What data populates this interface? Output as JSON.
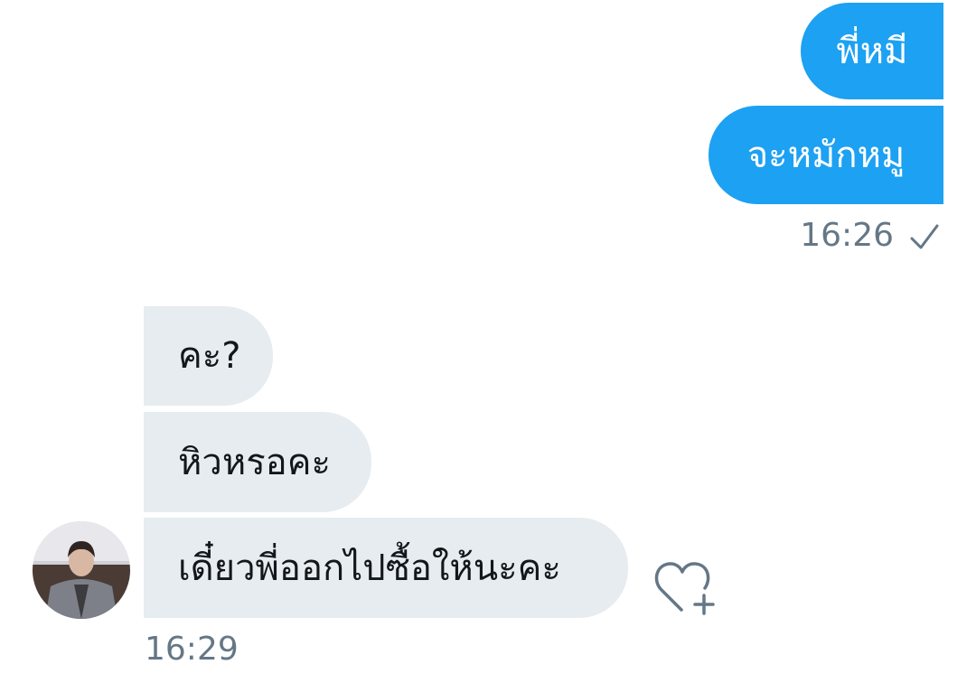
{
  "conversation": {
    "outgoing": [
      {
        "text": "พี่หมี"
      },
      {
        "text": "จะหมักหมู"
      }
    ],
    "outgoing_time": "16:26",
    "outgoing_status_icon": "checkmark-icon",
    "incoming": [
      {
        "text": "คะ?"
      },
      {
        "text": "หิวหรอคะ"
      },
      {
        "text": "เดี๋ยวพี่ออกไปซื้อให้นะคะ"
      }
    ],
    "incoming_time": "16:29",
    "like_icon": "heart-plus-icon",
    "avatar_icon": "user-avatar",
    "colors": {
      "outgoing_bubble": "#1da1f2",
      "incoming_bubble": "#e6ecf0",
      "meta_text": "#657786"
    }
  }
}
